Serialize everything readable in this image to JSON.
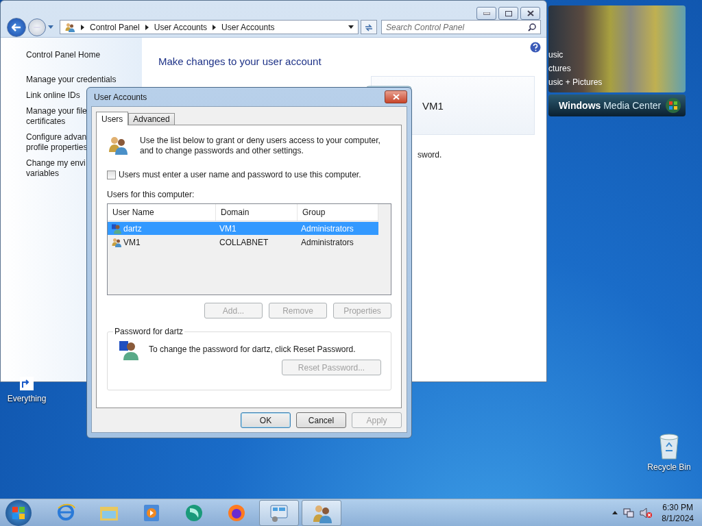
{
  "control_panel_window": {
    "breadcrumb": [
      "Control Panel",
      "User Accounts",
      "User Accounts"
    ],
    "search": {
      "placeholder": "Search Control Panel"
    },
    "sidebar": {
      "items": [
        {
          "lines": [
            "Control Panel Home"
          ]
        },
        {
          "lines": [
            "Manage your credentials"
          ]
        },
        {
          "lines": [
            "Link online IDs"
          ]
        },
        {
          "lines": [
            "Manage your file",
            "certificates"
          ]
        },
        {
          "lines": [
            "Configure advan",
            "profile properties"
          ]
        },
        {
          "lines": [
            "Change my envi",
            "variables"
          ]
        }
      ]
    },
    "heading": "Make changes to your user account",
    "account_tile": {
      "name": "VM1"
    },
    "partial_text": "sword."
  },
  "media_center": {
    "menu": [
      "usic",
      "ctures",
      "usic + Pictures"
    ],
    "brand": "**Windows** Media Center"
  },
  "dialog": {
    "title": "User Accounts",
    "tabs": [
      {
        "label": "Users",
        "selected": true
      },
      {
        "label": "Advanced",
        "selected": false
      }
    ],
    "intro": "Use the list below to grant or deny users access to your computer, and to change passwords and other settings.",
    "require_login": {
      "label": "Users must enter a user name and password to use this computer.",
      "checked": false
    },
    "list_label": "Users for this computer:",
    "table": {
      "columns": [
        "User Name",
        "Domain",
        "Group"
      ],
      "rows": [
        {
          "cells": [
            "dartz",
            "VM1",
            "Administrators"
          ],
          "selected": true
        },
        {
          "cells": [
            "VM1",
            "COLLABNET",
            "Administrators"
          ],
          "selected": false
        }
      ]
    },
    "list_buttons": [
      {
        "label": "Add...",
        "disabled": true
      },
      {
        "label": "Remove",
        "disabled": true
      },
      {
        "label": "Properties",
        "disabled": true
      }
    ],
    "password_group": {
      "title": "Password for dartz",
      "text": "To change the password for dartz, click Reset Password.",
      "button": {
        "label": "Reset Password...",
        "disabled": true
      }
    },
    "buttons": [
      {
        "label": "OK",
        "default": true,
        "disabled": false
      },
      {
        "label": "Cancel",
        "default": false,
        "disabled": false
      },
      {
        "label": "Apply",
        "default": false,
        "disabled": true
      }
    ]
  },
  "desktop_icons": [
    {
      "label": "Everything"
    },
    {
      "label": "Recycle Bin"
    }
  ],
  "taskbar": {
    "apps": [
      {
        "active": false
      },
      {
        "active": false
      },
      {
        "active": false
      },
      {
        "active": false
      },
      {
        "active": false
      },
      {
        "active": true
      },
      {
        "active": true
      }
    ],
    "clock": {
      "time": "6:30 PM",
      "date": "8/1/2024"
    }
  }
}
